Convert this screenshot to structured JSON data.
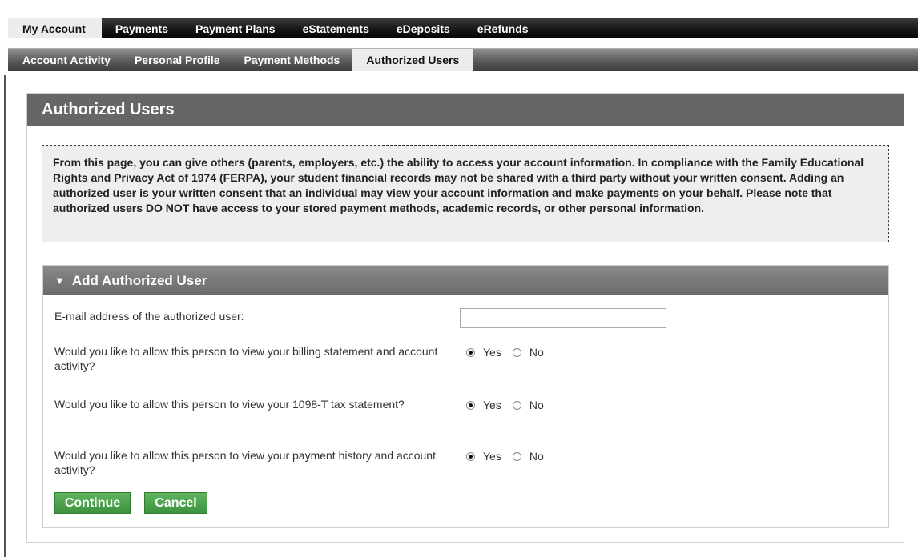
{
  "top_nav": {
    "tabs": [
      {
        "label": "My Account",
        "active": true
      },
      {
        "label": "Payments",
        "active": false
      },
      {
        "label": "Payment Plans",
        "active": false
      },
      {
        "label": "eStatements",
        "active": false
      },
      {
        "label": "eDeposits",
        "active": false
      },
      {
        "label": "eRefunds",
        "active": false
      }
    ]
  },
  "sub_nav": {
    "tabs": [
      {
        "label": "Account Activity",
        "active": false
      },
      {
        "label": "Personal Profile",
        "active": false
      },
      {
        "label": "Payment Methods",
        "active": false
      },
      {
        "label": "Authorized Users",
        "active": true
      }
    ]
  },
  "panel": {
    "title": "Authorized Users",
    "notice": "From this page, you can give others (parents, employers, etc.) the ability to access your account information. In compliance with the Family Educational Rights and Privacy Act of 1974 (FERPA), your student financial records may not be shared with a third party without your written consent. Adding an authorized user is your written consent that an individual may view your account information and make payments on your behalf. Please note that authorized users DO NOT have access to your stored payment methods, academic records, or other personal information."
  },
  "add_user": {
    "header": "Add Authorized User",
    "expand_icon": "triangle-down-icon",
    "email_label": "E-mail address of the authorized user:",
    "email_value": "",
    "questions": [
      {
        "text": "Would you like to allow this person to view your billing statement and account activity?",
        "selected": "Yes"
      },
      {
        "text": "Would you like to allow this person to view your 1098-T tax statement?",
        "selected": "Yes"
      },
      {
        "text": "Would you like to allow this person to view your payment history and account activity?",
        "selected": "Yes"
      }
    ],
    "yes_label": "Yes",
    "no_label": "No",
    "continue_label": "Continue",
    "cancel_label": "Cancel"
  },
  "colors": {
    "button_green": "#4aa34a",
    "header_gray": "#666666"
  }
}
